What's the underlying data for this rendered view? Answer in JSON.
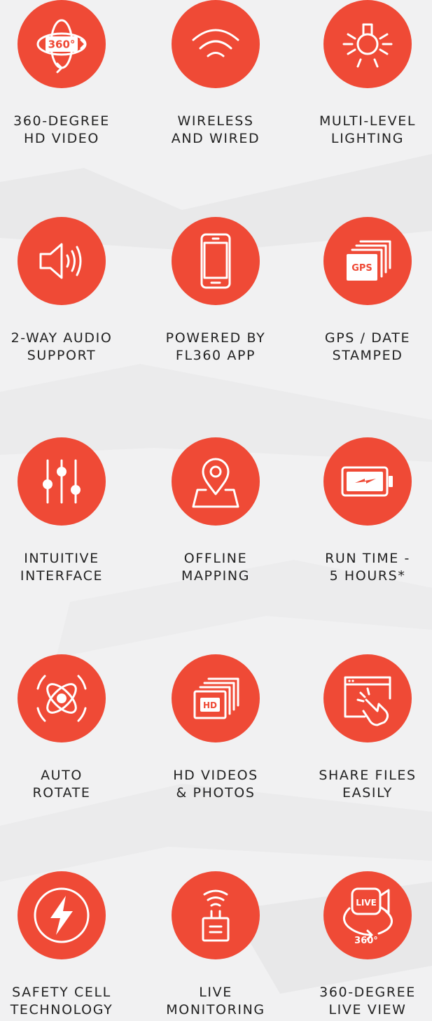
{
  "colors": {
    "accent": "#ef4a36",
    "background": "#f1f1f2",
    "text": "#222222"
  },
  "features": [
    {
      "icon": "360-rotation-icon",
      "line1": "360-DEGREE",
      "line2": "HD VIDEO",
      "icon_text": "360°"
    },
    {
      "icon": "wifi-icon",
      "line1": "WIRELESS",
      "line2": "AND WIRED"
    },
    {
      "icon": "lightbulb-icon",
      "line1": "MULTI-LEVEL",
      "line2": "LIGHTING"
    },
    {
      "icon": "speaker-icon",
      "line1": "2-WAY AUDIO",
      "line2": "SUPPORT"
    },
    {
      "icon": "smartphone-icon",
      "line1": "POWERED BY",
      "line2": "FL360 APP"
    },
    {
      "icon": "gps-stack-icon",
      "line1": "GPS / DATE",
      "line2": "STAMPED",
      "icon_text": "GPS"
    },
    {
      "icon": "sliders-icon",
      "line1": "INTUITIVE",
      "line2": "INTERFACE"
    },
    {
      "icon": "map-pin-icon",
      "line1": "OFFLINE",
      "line2": "MAPPING"
    },
    {
      "icon": "battery-charging-icon",
      "line1": "RUN TIME -",
      "line2": "5 HOURS*"
    },
    {
      "icon": "atom-rotate-icon",
      "line1": "AUTO",
      "line2": "ROTATE"
    },
    {
      "icon": "hd-stack-icon",
      "line1": "HD VIDEOS",
      "line2": "& PHOTOS",
      "icon_text": "HD"
    },
    {
      "icon": "touch-browser-icon",
      "line1": "SHARE FILES",
      "line2": "EASILY"
    },
    {
      "icon": "lightning-bolt-icon",
      "line1": "SAFETY CELL",
      "line2": "TECHNOLOGY"
    },
    {
      "icon": "wireless-device-icon",
      "line1": "LIVE",
      "line2": "MONITORING"
    },
    {
      "icon": "live-camera-360-icon",
      "line1": "360-DEGREE",
      "line2": "LIVE VIEW",
      "icon_text": "LIVE",
      "icon_text_2": "360°"
    }
  ]
}
